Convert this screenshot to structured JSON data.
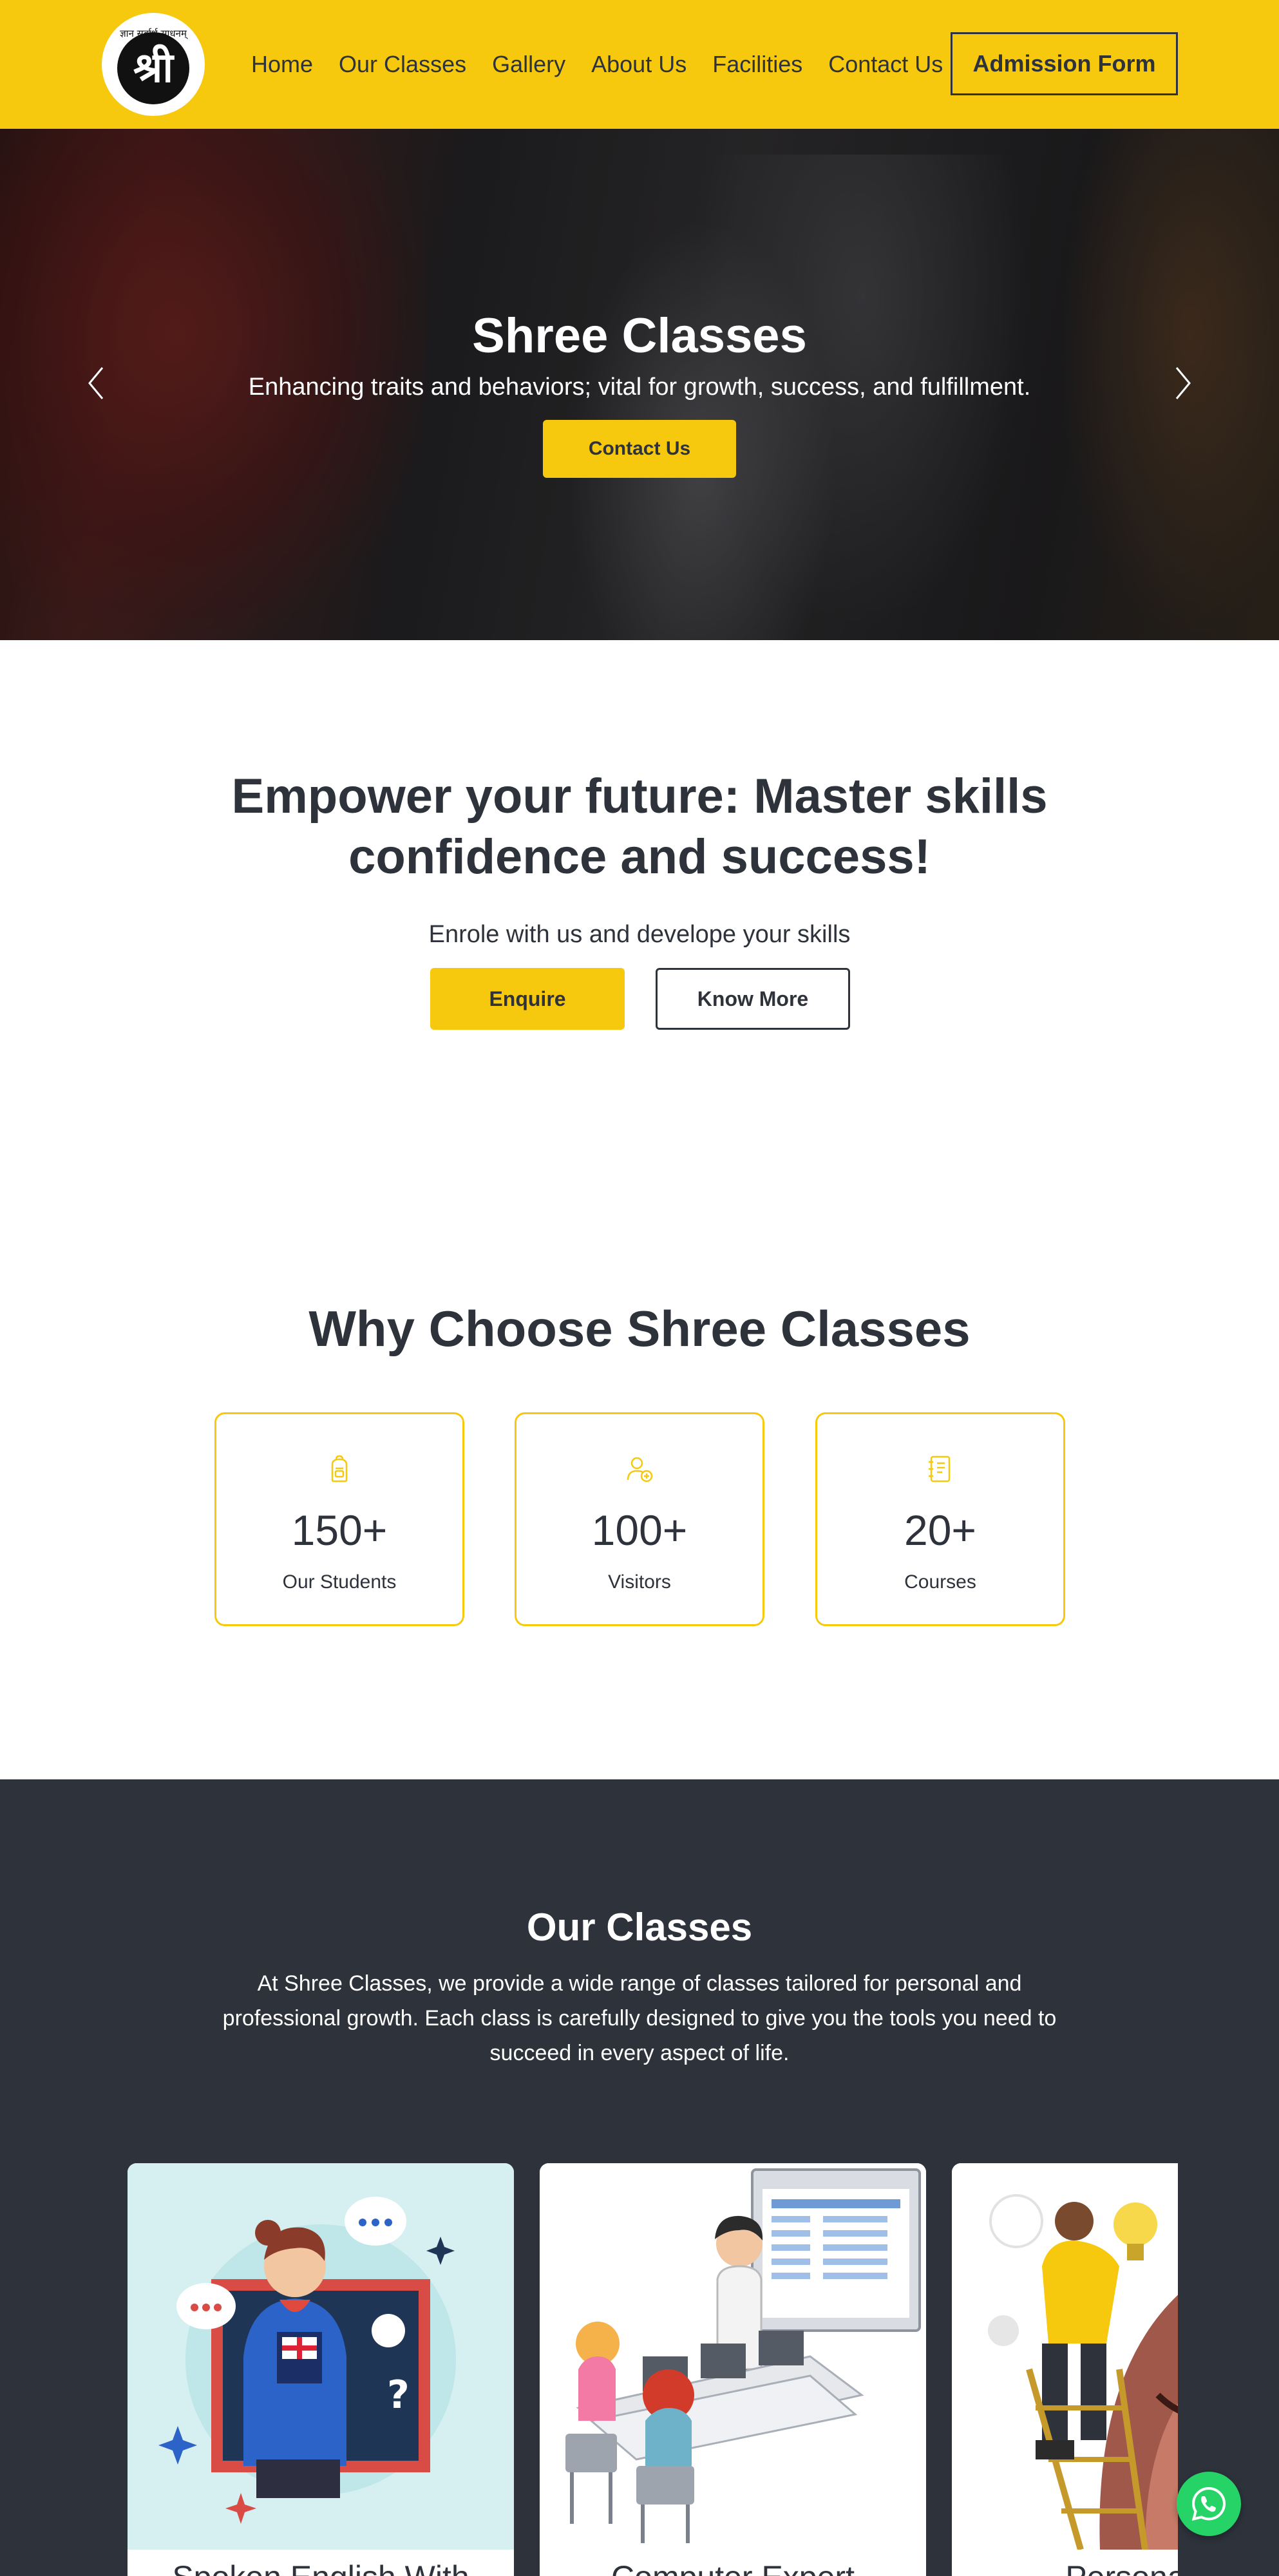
{
  "nav": {
    "logo_text": "श्री",
    "logo_arc_text": "ज्ञान सर्वार्थ साधनम्",
    "links": [
      "Home",
      "Our Classes",
      "Gallery",
      "About Us",
      "Facilities",
      "Contact Us"
    ],
    "admission_label": "Admission Form"
  },
  "hero": {
    "title": "Shree Classes",
    "subtitle": "Enhancing traits and behaviors; vital for growth, success, and fulfillment.",
    "button_label": "Contact Us",
    "prev_icon": "chevron-left-icon",
    "next_icon": "chevron-right-icon"
  },
  "empower": {
    "title": "Empower your future: Master skills confidence and success!",
    "subtitle": "Enrole with us and develope your skills",
    "enquire_label": "Enquire",
    "know_more_label": "Know More"
  },
  "why": {
    "title": "Why Choose Shree Classes",
    "stats": [
      {
        "icon": "backpack-icon",
        "value": "150+",
        "label": "Our Students"
      },
      {
        "icon": "user-add-icon",
        "value": "100+",
        "label": "Visitors"
      },
      {
        "icon": "notebook-icon",
        "value": "20+",
        "label": "Courses"
      }
    ]
  },
  "classes": {
    "title": "Our Classes",
    "description": "At Shree Classes, we provide a wide range of classes tailored for personal and professional growth. Each class is carefully designed to give you the tools you need to succeed in every aspect of life.",
    "cards": [
      {
        "title": "Spoken English With"
      },
      {
        "title": "Computer Expert"
      },
      {
        "title": "Personality"
      }
    ]
  },
  "colors": {
    "accent": "#f6c90f",
    "dark": "#2d323b",
    "whatsapp": "#25d366"
  },
  "whatsapp_icon": "whatsapp-icon"
}
